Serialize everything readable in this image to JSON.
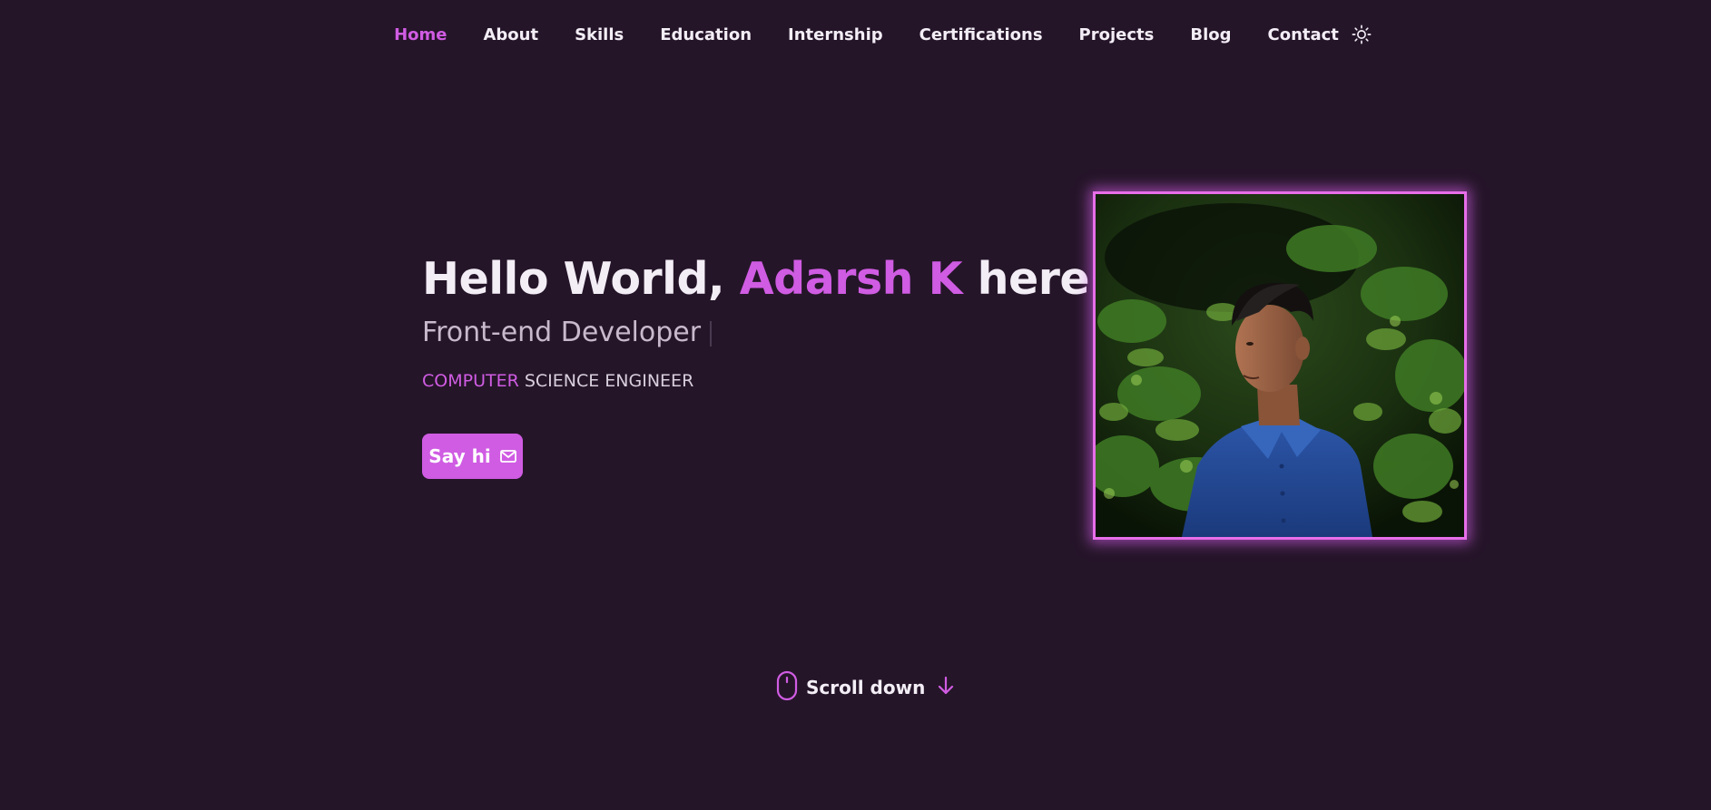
{
  "nav": {
    "items": [
      {
        "label": "Home",
        "active": true
      },
      {
        "label": "About"
      },
      {
        "label": "Skills"
      },
      {
        "label": "Education"
      },
      {
        "label": "Internship"
      },
      {
        "label": "Certifications"
      },
      {
        "label": "Projects"
      },
      {
        "label": "Blog"
      },
      {
        "label": "Contact"
      }
    ],
    "theme_toggle_icon": "sun-icon"
  },
  "hero": {
    "title_prefix": "Hello World, ",
    "title_name": "Adarsh K",
    "title_suffix": " here.",
    "subtitle": "Front-end Developer",
    "tagline_accent": "COMPUTER",
    "tagline_rest": " SCIENCE ENGINEER",
    "cta_label": "Say hi",
    "cta_icon": "mail-icon"
  },
  "scroll": {
    "label": "Scroll down",
    "mouse_icon": "mouse-icon",
    "arrow_icon": "arrow-down-icon"
  },
  "colors": {
    "background": "#251529",
    "accent": "#d05ce3",
    "text": "#f3eef6"
  }
}
